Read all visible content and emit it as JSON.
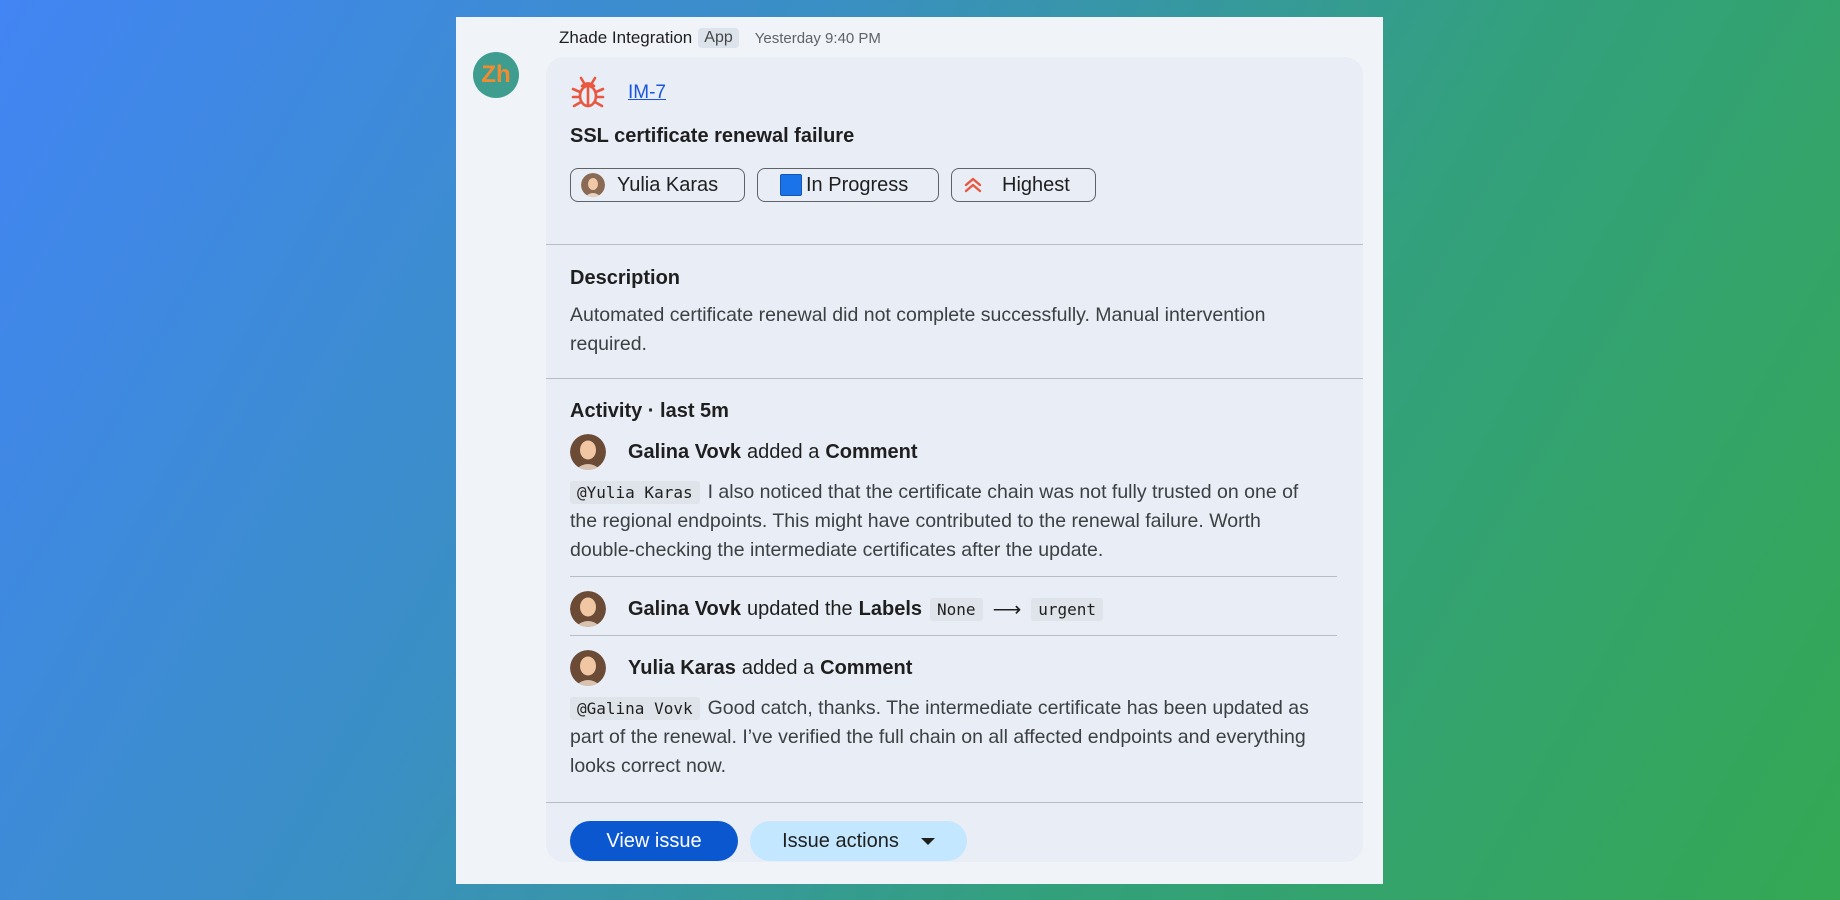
{
  "message": {
    "sender": "Zhade Integration",
    "app_badge": "App",
    "timestamp": "Yesterday 9:40 PM",
    "avatar_text": "Zh"
  },
  "issue": {
    "key": "IM-7",
    "title": "SSL certificate renewal failure",
    "icon": "bug-icon",
    "chips": {
      "assignee": "Yulia Karas",
      "status": "In Progress",
      "priority": "Highest"
    }
  },
  "description": {
    "heading": "Description",
    "body": "Automated certificate renewal did not complete successfully. Manual intervention required."
  },
  "activity": {
    "heading": "Activity · last 5m",
    "items": [
      {
        "author": "Galina Vovk",
        "verb": "added a",
        "object": "Comment",
        "mention": "@Yulia Karas",
        "body": "I also noticed that the certificate chain was not fully trusted on one of the regional endpoints. This might have contributed to the renewal failure. Worth double-checking the intermediate certificates after the update."
      },
      {
        "author": "Galina Vovk",
        "verb": "updated the",
        "object": "Labels",
        "from": "None",
        "arrow": "⟶",
        "to": "urgent"
      },
      {
        "author": "Yulia Karas",
        "verb": "added a",
        "object": "Comment",
        "mention": "@Galina Vovk",
        "body": "Good catch, thanks. The intermediate certificate has been updated as part of the renewal. I’ve verified the full chain on all affected endpoints and everything looks correct now."
      }
    ]
  },
  "actions": {
    "view_issue": "View issue",
    "issue_actions": "Issue actions"
  },
  "colors": {
    "primary_button": "#0b57d0",
    "secondary_button": "#c2e7ff",
    "link": "#1a56db",
    "bug_icon": "#e8573f",
    "status_square": "#1a73e8"
  }
}
